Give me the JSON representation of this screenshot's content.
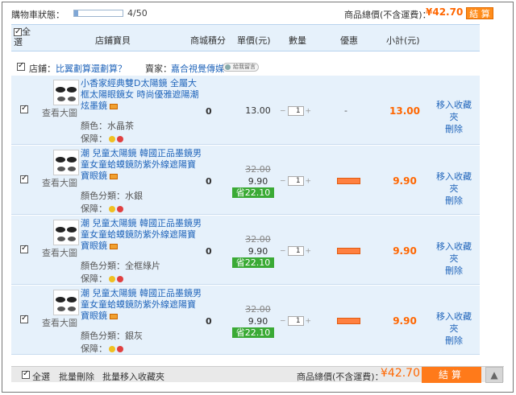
{
  "cart_status": {
    "label": "購物車狀態：",
    "progress_fraction": 0.08,
    "count": "4/50"
  },
  "summary": {
    "total_label": "商品總價(不含運費)：",
    "total_value": "¥42.70",
    "checkout_small": "結 算"
  },
  "header": {
    "select_all": "全選",
    "col_product": "店鋪寶貝",
    "col_points": "商城積分",
    "col_price": "單價(元)",
    "col_qty": "數量",
    "col_promo": "優惠",
    "col_subtotal": "小計(元)"
  },
  "store": {
    "store_label": "店鋪：",
    "store_name": "比翼劃算還劃算？",
    "seller_label": "賣家：",
    "seller_name": "嘉合視覺傳媒",
    "message_label": "給我留言"
  },
  "items": [
    {
      "view_large": "查看大圖",
      "title": "小香家經典雙D太陽鏡 全屬大框太陽眼鏡女 時尚優雅遮陽潮炫墨鏡",
      "spec": "顏色：水晶茶",
      "guarantee": "保障：",
      "points": "0",
      "original_price": "",
      "price": "13.00",
      "saving": "",
      "qty": "1",
      "promo": "-",
      "subtotal": "13.00",
      "fav": "移入收藏夾",
      "del": "刪除"
    },
    {
      "view_large": "查看大圖",
      "title": "潮 兒童太陽鏡 韓國正品墨鏡男童女童蛤蟆鏡防紫外線遮陽寶寶眼鏡",
      "spec": "顏色分類：水銀",
      "guarantee": "保障：",
      "points": "0",
      "original_price": "32.00",
      "price": "9.90",
      "saving": "省22.10",
      "qty": "1",
      "promo": "",
      "subtotal": "9.90",
      "fav": "移入收藏夾",
      "del": "刪除"
    },
    {
      "view_large": "查看大圖",
      "title": "潮 兒童太陽鏡 韓國正品墨鏡男童女童蛤蟆鏡防紫外線遮陽寶寶眼鏡",
      "spec": "顏色分類：全框綠片",
      "guarantee": "保障：",
      "points": "0",
      "original_price": "32.00",
      "price": "9.90",
      "saving": "省22.10",
      "qty": "1",
      "promo": "",
      "subtotal": "9.90",
      "fav": "移入收藏夾",
      "del": "刪除"
    },
    {
      "view_large": "查看大圖",
      "title": "潮 兒童太陽鏡 韓國正品墨鏡男童女童蛤蟆鏡防紫外線遮陽寶寶眼鏡",
      "spec": "顏色分類：銀灰",
      "guarantee": "保障：",
      "points": "0",
      "original_price": "32.00",
      "price": "9.90",
      "saving": "省22.10",
      "qty": "1",
      "promo": "",
      "subtotal": "9.90",
      "fav": "移入收藏夾",
      "del": "刪除"
    }
  ],
  "footer": {
    "select_all": "全選",
    "batch_delete": "批量刪除",
    "batch_fav": "批量移入收藏夾",
    "total_label": "商品總價(不含運費)：",
    "total_value": "¥42.70",
    "checkout": "結算",
    "to_top_icon": "arrow-up-icon"
  },
  "colors": {
    "accent_orange": "#ff6600",
    "row_blue": "#e6f1fb",
    "link_blue": "#2266bb",
    "saving_green": "#3aaa35"
  }
}
